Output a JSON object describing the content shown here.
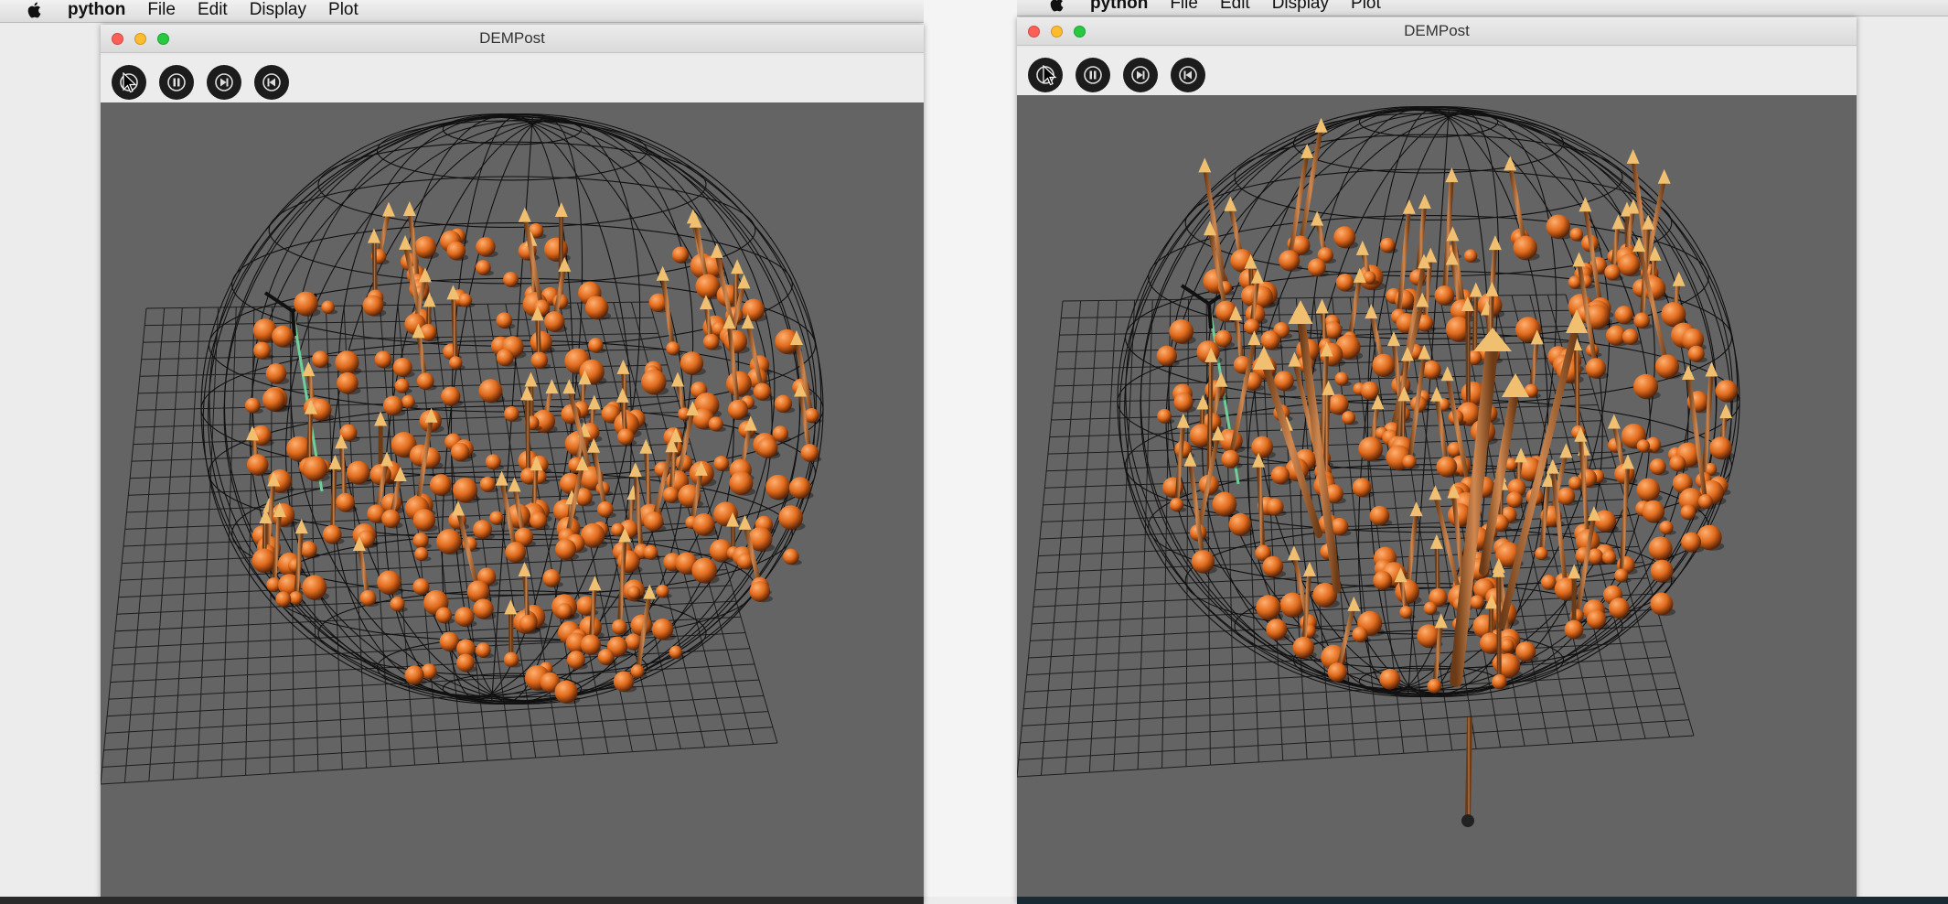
{
  "menubar": {
    "app_name": "python",
    "menus": [
      "File",
      "Edit",
      "Display",
      "Plot"
    ]
  },
  "windows": [
    {
      "title": "DEMPost",
      "toolbar": [
        "play-icon",
        "pause-icon",
        "step-forward-icon",
        "rewind-icon"
      ]
    },
    {
      "title": "DEMPost",
      "toolbar": [
        "play-icon",
        "pause-icon",
        "step-forward-icon",
        "rewind-icon"
      ]
    }
  ],
  "colors": {
    "viewport_bg": "#646464",
    "particle": "#e06a1c",
    "arrow_shaft": "#b06a35",
    "arrow_head": "#f0c070",
    "wireframe": "#111111",
    "axis_green": "#6fcf97",
    "traffic_close": "#fe5f57",
    "traffic_min": "#febc2e",
    "traffic_max": "#28c840"
  }
}
